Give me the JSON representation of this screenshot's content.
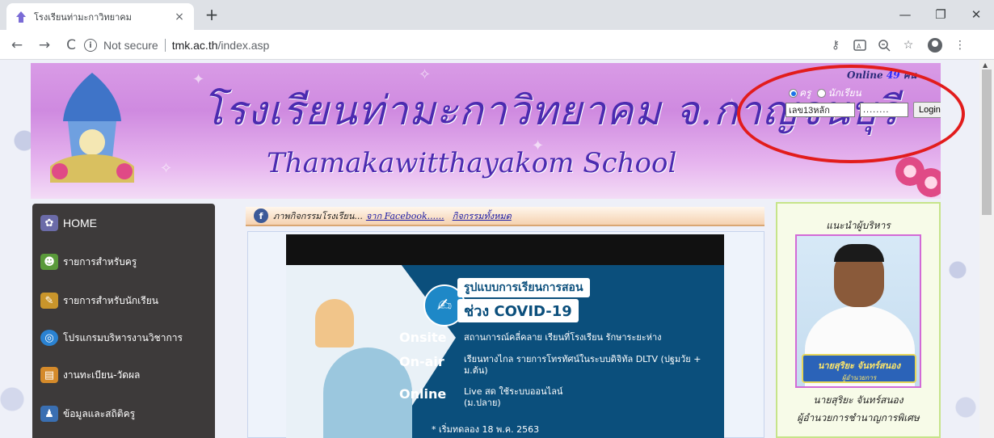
{
  "browser": {
    "tab_title": "โรงเรียนท่ามะกาวิทยาคม",
    "tab_close": "×",
    "new_tab": "+",
    "window": {
      "minimize": "—",
      "restore": "❐",
      "close": "✕"
    },
    "nav": {
      "back": "←",
      "forward": "→",
      "reload": "C"
    },
    "security_label": "Not secure",
    "url_host": "tmk.ac.th",
    "url_path": "/index.asp",
    "toolbar_icons": [
      "key-icon",
      "translate-icon",
      "zoom-icon",
      "star-icon",
      "profile-icon",
      "menu-icon"
    ]
  },
  "banner": {
    "title": "โรงเรียนท่ามะกาวิทยาคม จ.กาญจนบุรี",
    "subtitle": "Thamakawitthayakom School",
    "online_prefix": "Online",
    "online_count": "49",
    "online_suffix": "คน",
    "role_teacher": "ครู",
    "role_student": "นักเรียน",
    "username_placeholder": "เลข13หลัก",
    "password_value": "........",
    "login_label": "Login"
  },
  "menu": {
    "items": [
      {
        "label": "HOME",
        "icon": "home-icon"
      },
      {
        "label": "รายการสำหรับครู",
        "icon": "people-icon"
      },
      {
        "label": "รายการสำหรับนักเรียน",
        "icon": "student-icon"
      },
      {
        "label": "โปรแกรมบริหารงานวิชาการ",
        "icon": "globe-icon"
      },
      {
        "label": "งานทะเบียน-วัดผล",
        "icon": "register-icon"
      },
      {
        "label": "ข้อมูลและสถิติครู",
        "icon": "teacher-stats-icon"
      }
    ]
  },
  "news": {
    "text": "ภาพกิจกรรมโรงเรียน...",
    "link_facebook": "จาก Facebook......",
    "link_all": "กิจกรรมทั้งหมด"
  },
  "covid": {
    "headline1": "รูปแบบการเรียนการสอน",
    "headline2": "ช่วง COVID-19",
    "rows": [
      {
        "key": "Onsite",
        "value": "สถานการณ์คลี่คลาย เรียนที่โรงเรียน รักษาระยะห่าง"
      },
      {
        "key": "On-air",
        "value": "เรียนทางไกล รายการโทรทัศน์ในระบบดิจิทัล DLTV (ปฐมวัย + ม.ต้น)"
      },
      {
        "key": "Online",
        "value": "Live สด ใช้ระบบออนไลน์ (ม.ปลาย)"
      }
    ],
    "note": "* เริ่มทดลอง 18 พ.ค. 2563"
  },
  "admin": {
    "title": "แนะนำผู้บริหาร",
    "plate_name": "นายสุริยะ จันทร์สนอง",
    "plate_role": "ผู้อำนวยการ",
    "name": "นายสุริยะ จันทร์สนอง",
    "role": "ผู้อำนวยการชำนาญการพิเศษ"
  },
  "colors": {
    "accent_ellipse": "#e21c1c",
    "banner_text": "#4b2bb0",
    "menu_bg": "#3d3a3a"
  }
}
